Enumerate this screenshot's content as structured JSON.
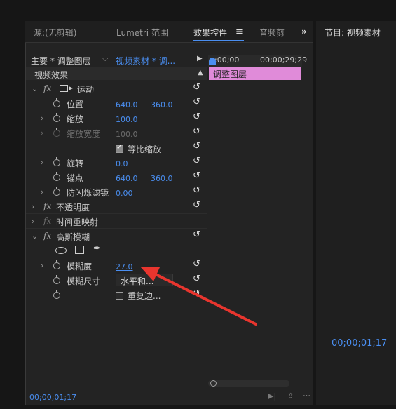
{
  "tabs": [
    "源:(无剪辑)",
    "Lumetri 范围",
    "效果控件",
    "音频剪",
    "»"
  ],
  "active_tab": "效果控件",
  "tab_menu_icon": "hamburger-icon",
  "program_monitor": {
    "title": "节目: 视频素材",
    "timecode": "00;00;01;17"
  },
  "clip_selector": {
    "master": "主要 * 调整图层",
    "clip": "视频素材 * 调..."
  },
  "timeline": {
    "start": ":00;00",
    "end": "00;00;29;29",
    "clip_label": "调整图层",
    "clip_color": "#e08bd9"
  },
  "section_header": "视频效果",
  "motion": {
    "name": "运动",
    "position": {
      "label": "位置",
      "x": "640.0",
      "y": "360.0"
    },
    "scale": {
      "label": "缩放",
      "value": "100.0"
    },
    "scale_width": {
      "label": "缩放宽度",
      "value": "100.0"
    },
    "uniform_scale": {
      "label": "等比缩放",
      "checked": true
    },
    "rotation": {
      "label": "旋转",
      "value": "0.0"
    },
    "anchor": {
      "label": "锚点",
      "x": "640.0",
      "y": "360.0"
    },
    "antiflicker": {
      "label": "防闪烁滤镜",
      "value": "0.00"
    }
  },
  "opacity": {
    "name": "不透明度"
  },
  "time_remap": {
    "name": "时间重映射"
  },
  "gaussian_blur": {
    "name": "高斯模糊",
    "blurriness": {
      "label": "模糊度",
      "value": "27.0"
    },
    "dimension": {
      "label": "模糊尺寸",
      "value": "水平和..."
    },
    "repeat_edge": {
      "label": "重复边...",
      "checked": false
    }
  },
  "footer_timecode": "00;00;01;17",
  "annotation_color": "#e8352e"
}
